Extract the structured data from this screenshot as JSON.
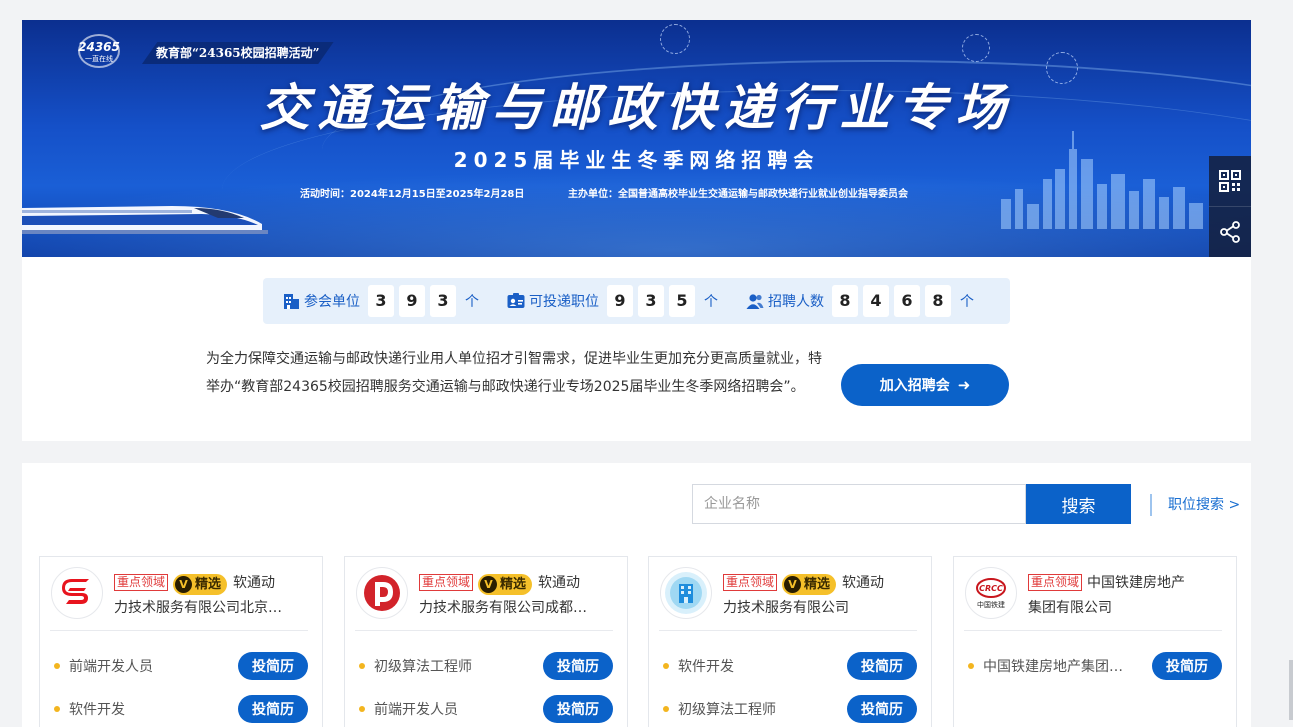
{
  "banner": {
    "logo_text": "24365",
    "logo_sub": "一直在线",
    "ministry_tag": "教育部“24365校园招聘活动”",
    "title": "交通运输与邮政快递行业专场",
    "subtitle": "2025届毕业生冬季网络招聘会",
    "activity_time": "活动时间：2024年12月15日至2025年2月28日",
    "host": "主办单位：全国普通高校毕业生交通运输与邮政快递行业就业创业指导委员会"
  },
  "stats": [
    {
      "label": "参会单位",
      "digits": [
        "3",
        "9",
        "3"
      ],
      "unit": "个",
      "icon": "building-icon"
    },
    {
      "label": "可投递职位",
      "digits": [
        "9",
        "3",
        "5"
      ],
      "unit": "个",
      "icon": "id-card-icon"
    },
    {
      "label": "招聘人数",
      "digits": [
        "8",
        "4",
        "6",
        "8"
      ],
      "unit": "个",
      "icon": "people-icon"
    }
  ],
  "intro": {
    "text": "为全力保障交通运输与邮政快递行业用人单位招才引智需求，促进毕业生更加充分更高质量就业，特举办“教育部24365校园招聘服务交通运输与邮政快递行业专场2025届毕业生冬季网络招聘会”。",
    "join_label": "加入招聘会",
    "join_arrow": "➜"
  },
  "search": {
    "placeholder": "企业名称",
    "button_label": "搜索",
    "job_search_label": "职位搜索 >"
  },
  "companies": [
    {
      "badge_key": "重点领域",
      "badge_pick": "精选",
      "name_line1": "软通动",
      "name_line2": "力技术服务有限公司北京…",
      "jobs": [
        {
          "title": "前端开发人员",
          "apply": "投简历"
        },
        {
          "title": "软件开发",
          "apply": "投简历"
        }
      ]
    },
    {
      "badge_key": "重点领域",
      "badge_pick": "精选",
      "name_line1": "软通动",
      "name_line2": "力技术服务有限公司成都…",
      "jobs": [
        {
          "title": "初级算法工程师",
          "apply": "投简历"
        },
        {
          "title": "前端开发人员",
          "apply": "投简历"
        }
      ]
    },
    {
      "badge_key": "重点领域",
      "badge_pick": "精选",
      "name_line1": "软通动",
      "name_line2": "力技术服务有限公司",
      "jobs": [
        {
          "title": "软件开发",
          "apply": "投简历"
        },
        {
          "title": "初级算法工程师",
          "apply": "投简历"
        }
      ]
    },
    {
      "badge_key": "重点领域",
      "badge_pick": "",
      "name_line1": "中国铁建房地产",
      "name_line2": "集团有限公司",
      "logo_text": "中国铁建",
      "jobs": [
        {
          "title": "中国铁建房地产集团…",
          "apply": "投简历"
        }
      ]
    }
  ],
  "colors": {
    "primary": "#0b62c9",
    "accent": "#f5c02a",
    "badge_red": "#e03a3a"
  }
}
